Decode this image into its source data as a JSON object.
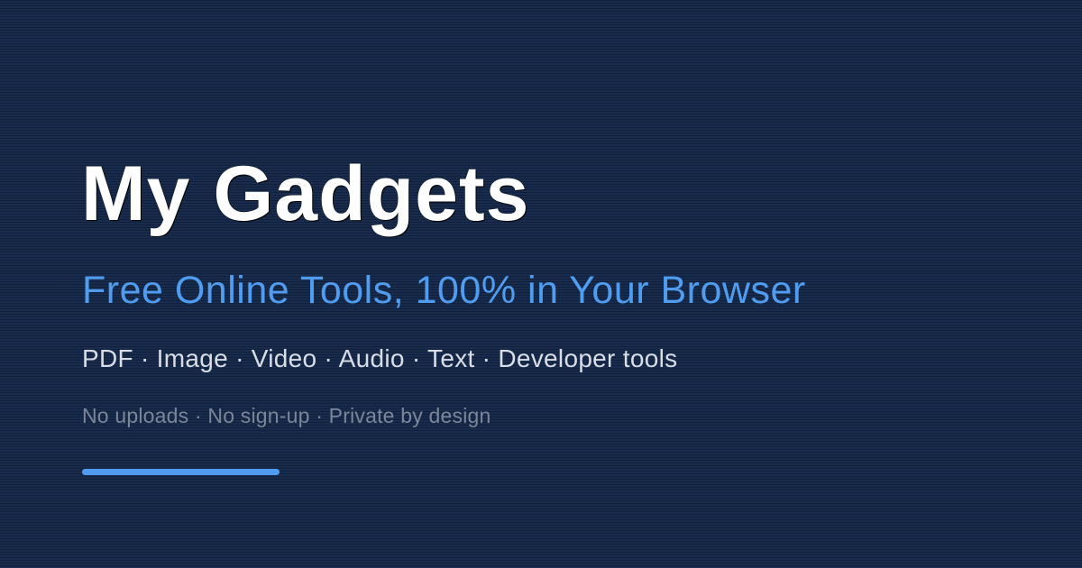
{
  "card": {
    "title": "My Gadgets",
    "subtitle": "Free Online Tools, 100% in Your Browser",
    "categories": "PDF · Image · Video · Audio · Text · Developer tools",
    "tagline": "No uploads · No sign-up · Private by design"
  },
  "colors": {
    "background": "#15294a",
    "title": "#ffffff",
    "accent": "#4f9cf0",
    "categories": "#d8dde6",
    "tagline": "#7b8698"
  }
}
